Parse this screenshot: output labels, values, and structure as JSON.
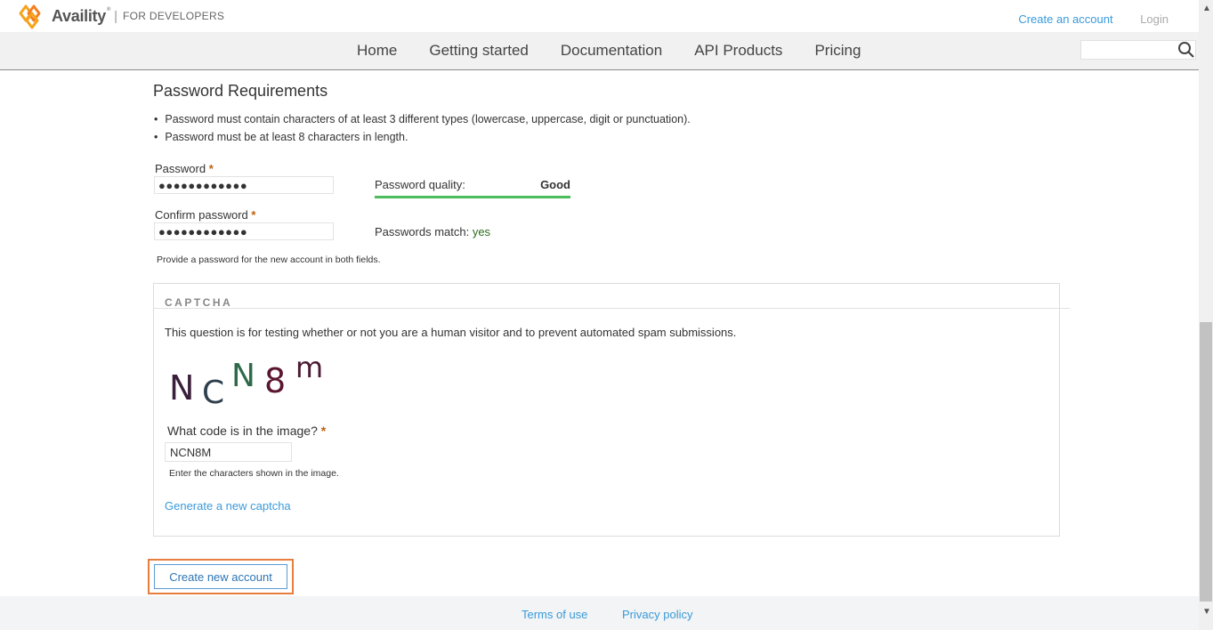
{
  "header": {
    "brand": "Availity",
    "brand_mark": "®",
    "brand_sub": "FOR DEVELOPERS",
    "create_account": "Create an account",
    "login": "Login"
  },
  "nav": {
    "items": [
      "Home",
      "Getting started",
      "Documentation",
      "API Products",
      "Pricing"
    ],
    "search_placeholder": ""
  },
  "password_section": {
    "title": "Password Requirements",
    "requirements": [
      "Password must contain characters of at least 3 different types (lowercase, uppercase, digit or punctuation).",
      "Password must be at least 8 characters in length."
    ],
    "password_label": "Password",
    "password_value": "●●●●●●●●●●●●",
    "confirm_label": "Confirm password",
    "confirm_value": "●●●●●●●●●●●●",
    "required_marker": "*",
    "quality_label": "Password quality:",
    "quality_value": "Good",
    "match_label": "Passwords match:",
    "match_value": "yes",
    "description": "Provide a password for the new account in both fields."
  },
  "captcha": {
    "legend": "CAPTCHA",
    "description": "This question is for testing whether or not you are a human visitor and to prevent automated spam submissions.",
    "image_chars": [
      "N",
      "C",
      "N",
      "8",
      "m"
    ],
    "question": "What code is in the image?",
    "required_marker": "*",
    "input_value": "NCN8M",
    "hint": "Enter the characters shown in the image.",
    "regenerate": "Generate a new captcha"
  },
  "submit": {
    "label": "Create new account"
  },
  "footer": {
    "terms": "Terms of use",
    "privacy": "Privacy policy"
  },
  "colors": {
    "accent": "#3a9ad9",
    "quality_bar": "#4cbd5c",
    "required": "#c0600a",
    "highlight": "#e87e3e"
  },
  "icons": [
    "availity-logo-icon",
    "search-icon",
    "scroll-up-icon",
    "scroll-down-icon"
  ]
}
